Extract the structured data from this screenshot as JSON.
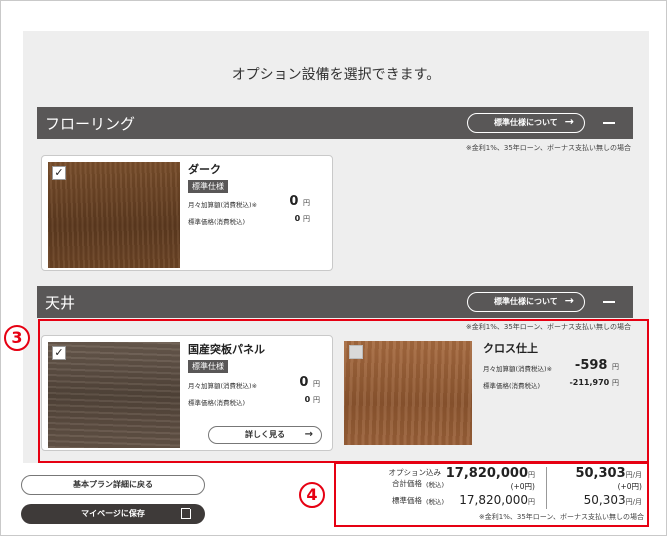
{
  "headline": "オプション設備を選択できます。",
  "common": {
    "std_spec_button": "標準仕様について",
    "std_spec_arrow": "→",
    "loan_note": "※金利1%、35年ローン、ボーナス支払い無しの場合",
    "monthly_add_label": "月々加算額(消費税込)※",
    "std_price_label": "標準価格(消費税込)",
    "std_badge": "標準仕様",
    "yen": "円",
    "yen_per_month": "円/月",
    "check_mark": "✓"
  },
  "sections": [
    {
      "title": "フローリング",
      "options": [
        {
          "name": "ダーク",
          "badge": "標準仕様",
          "monthly": "0",
          "std_price": "0",
          "checked": true
        }
      ]
    },
    {
      "title": "天井",
      "options": [
        {
          "name": "国産突板パネル",
          "badge": "標準仕様",
          "monthly": "0",
          "std_price": "0",
          "checked": true,
          "detail_button": "詳しく見る"
        },
        {
          "name": "クロス仕上",
          "monthly": "-598",
          "std_price": "-211,970",
          "checked": false
        }
      ]
    }
  ],
  "markers": {
    "three": "3",
    "four": "4"
  },
  "buttons": {
    "back": "基本プラン詳細に戻る",
    "save": "マイページに保存"
  },
  "summary": {
    "total_label_1": "オプション込み",
    "total_label_2": "合計価格",
    "tax_in": "(税込)",
    "std_label": "標準価格",
    "total_price": "17,820,000",
    "total_diff": "(+0円)",
    "std_price": "17,820,000",
    "monthly_total": "50,303",
    "monthly_diff": "(+0円)",
    "monthly_std": "50,303",
    "note": "※金利1%、35年ローン、ボーナス支払い無しの場合"
  }
}
